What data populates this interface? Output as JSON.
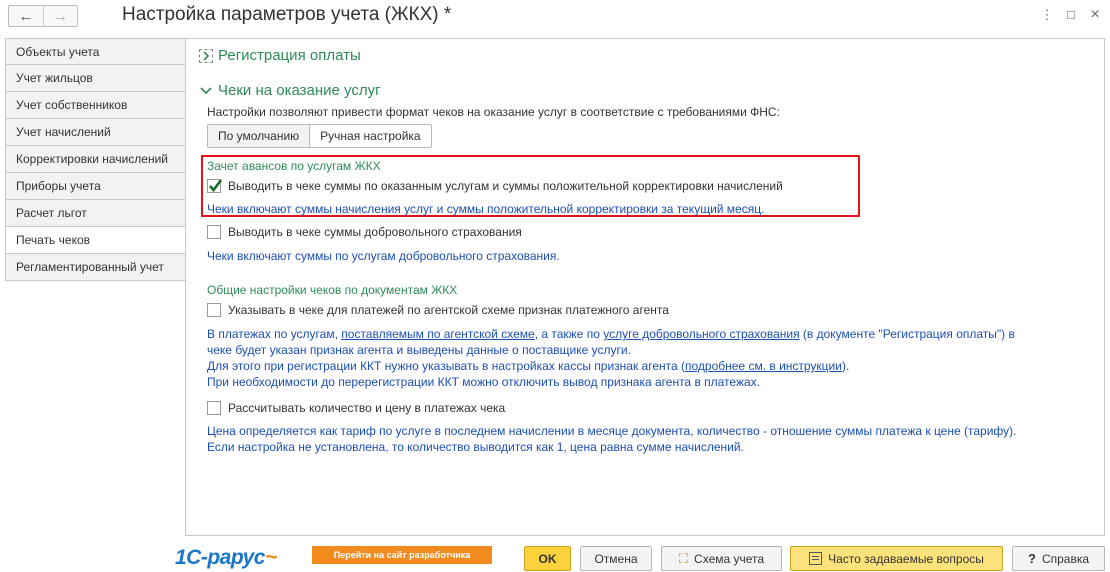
{
  "header": {
    "title": "Настройка параметров учета (ЖКХ) *",
    "back_icon": "←",
    "forward_icon": "→",
    "menu_icon": "⋮",
    "maximize_icon": "□",
    "close_icon": "×"
  },
  "sidebar": {
    "items": [
      {
        "label": "Объекты учета"
      },
      {
        "label": "Учет жильцов"
      },
      {
        "label": "Учет собственников"
      },
      {
        "label": "Учет начислений"
      },
      {
        "label": "Корректировки начислений"
      },
      {
        "label": "Приборы учета"
      },
      {
        "label": "Расчет льгот"
      },
      {
        "label": "Печать чеков",
        "active": true
      },
      {
        "label": "Регламентированный учет"
      }
    ]
  },
  "main": {
    "payment_group_title": "Регистрация оплаты",
    "receipts_group_title": "Чеки на оказание услуг",
    "receipts_description": "Настройки позволяют привести формат чеков на оказание услуг в соответствие с требованиями ФНС:",
    "mode_default": "По умолчанию",
    "mode_manual": "Ручная настройка",
    "selected_mode": "Ручная настройка",
    "advances_title": "Зачет авансов по услугам ЖКХ",
    "advances_checkbox": {
      "label": "Выводить в чеке суммы по оказанным услугам и суммы положительной корректировки начислений",
      "checked": true
    },
    "advances_note": "Чеки включают суммы начисления услуг и суммы положительной корректировки за текущий месяц.",
    "insurance_checkbox": {
      "label": "Выводить в чеке суммы добровольного страхования",
      "checked": false
    },
    "insurance_note": "Чеки включают суммы по услугам добровольного страхования.",
    "general_title": "Общие настройки чеков по документам ЖКХ",
    "agent_checkbox": {
      "label": "Указывать в чеке для платежей по агентской схеме признак платежного агента",
      "checked": false
    },
    "agent_note": {
      "l1_a": "В платежах по услугам, ",
      "l1_link1": "поставляемым по агентской схеме",
      "l1_b": ", а также по ",
      "l1_link2": "услуге добровольного страхования",
      "l1_c": " (в документе \"Регистрация оплаты\") в",
      "l2": "чеке будет указан признак агента и выведены данные о поставщике услуги.",
      "l3_a": "Для этого при регистрации ККТ нужно указывать в настройках кассы признак агента (",
      "l3_link": "подробнее см. в инструкции",
      "l3_b": ").",
      "l4": "При необходимости до перерегистрации ККТ можно отключить вывод признака агента в платежах."
    },
    "qty_checkbox": {
      "label": "Рассчитывать количество и цену в платежах чека",
      "checked": false
    },
    "qty_note": {
      "l1": "Цена определяется как тариф по услуге в последнем начислении в месяце документа, количество - отношение суммы платежа к цене (тарифу).",
      "l2": "Если настройка не установлена, то количество выводится как 1, цена равна сумме начислений."
    }
  },
  "footer": {
    "logo_main": "1С-рарус",
    "dev_link": "Перейти на сайт разработчика",
    "ok": "OK",
    "cancel": "Отмена",
    "scheme": "Схема учета",
    "faq": "Часто задаваемые вопросы",
    "help": "Справка",
    "scheme_icon": "⛶",
    "help_icon": "?"
  },
  "colors": {
    "accent_green": "#2e8b57",
    "note_blue": "#1c4fb3",
    "highlight_red": "#e2141a",
    "ok_yellow": "#fbd23c",
    "logo_orange": "#f28a1d"
  }
}
